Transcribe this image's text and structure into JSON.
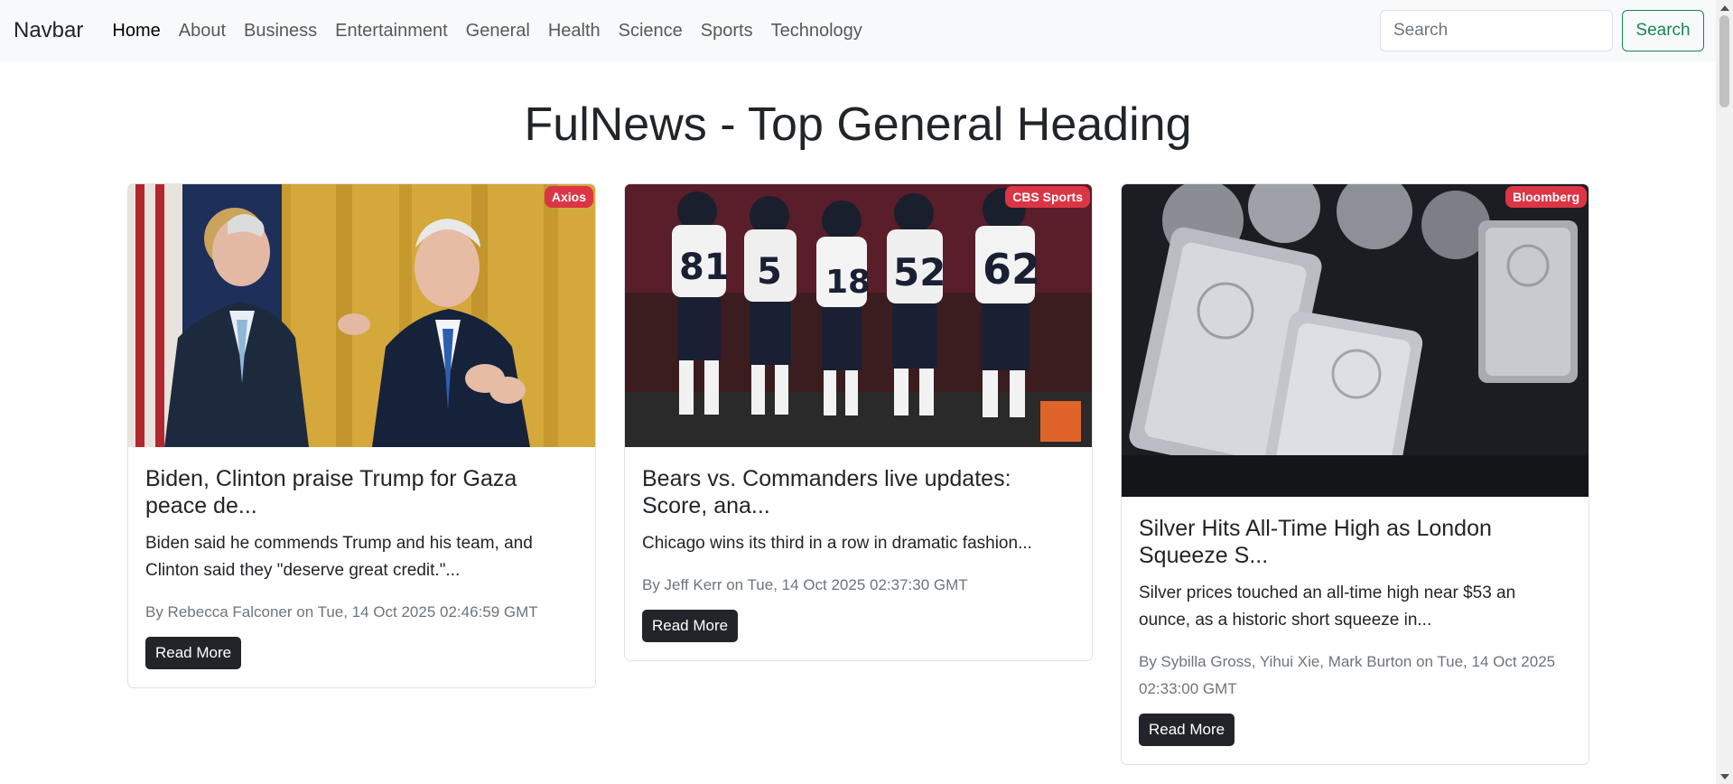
{
  "navbar": {
    "brand": "Navbar",
    "links": [
      "Home",
      "About",
      "Business",
      "Entertainment",
      "General",
      "Health",
      "Science",
      "Sports",
      "Technology"
    ],
    "active": "Home",
    "search_placeholder": "Search",
    "search_button": "Search"
  },
  "page": {
    "title": "FulNews - Top General Heading"
  },
  "colors": {
    "navbar_bg": "#f8f9fa",
    "badge_bg": "#dc3545",
    "search_button": "#198754",
    "read_more_bg": "#212529"
  },
  "cards": [
    {
      "source": "Axios",
      "title": "Biden, Clinton praise Trump for Gaza peace de...",
      "description": "Biden said he commends Trump and his team, and Clinton said they \"deserve great credit.\"...",
      "meta": "By Rebecca Falconer on Tue, 14 Oct 2025 02:46:59 GMT",
      "button": "Read More",
      "image": "two-men-applauding-photo"
    },
    {
      "source": "CBS Sports",
      "title": "Bears vs. Commanders live updates: Score, ana...",
      "description": "Chicago wins its third in a row in dramatic fashion...",
      "meta": "By Jeff Kerr on Tue, 14 Oct 2025 02:37:30 GMT",
      "button": "Read More",
      "image": "football-players-photo"
    },
    {
      "source": "Bloomberg",
      "title": "Silver Hits All-Time High as London Squeeze S...",
      "description": "Silver prices touched an all-time high near $53 an ounce, as a historic short squeeze in...",
      "meta": "By Sybilla Gross, Yihui Xie, Mark Burton on Tue, 14 Oct 2025 02:33:00 GMT",
      "button": "Read More",
      "image": "silver-bars-photo"
    }
  ]
}
